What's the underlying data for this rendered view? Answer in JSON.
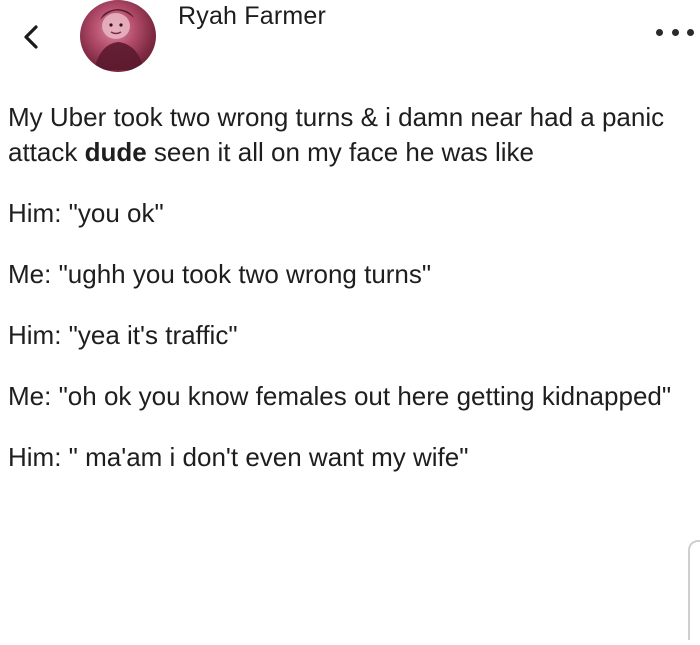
{
  "header": {
    "back_icon": "chevron-left-icon",
    "author_name": "Ryah Farmer",
    "more_icon": "ellipsis-icon"
  },
  "post": {
    "intro_before": "My Uber took two wrong turns & i damn near had a panic attack ",
    "intro_bold": "dude",
    "intro_after": " seen it all on my face he was like",
    "lines": [
      "Him: \"you ok\"",
      "Me: \"ughh you took two wrong turns\"",
      "Him: \"yea it's traffic\"",
      "Me: \"oh ok you know females out here getting kidnapped\"",
      "Him: \" ma'am i don't even want my wife\""
    ]
  }
}
